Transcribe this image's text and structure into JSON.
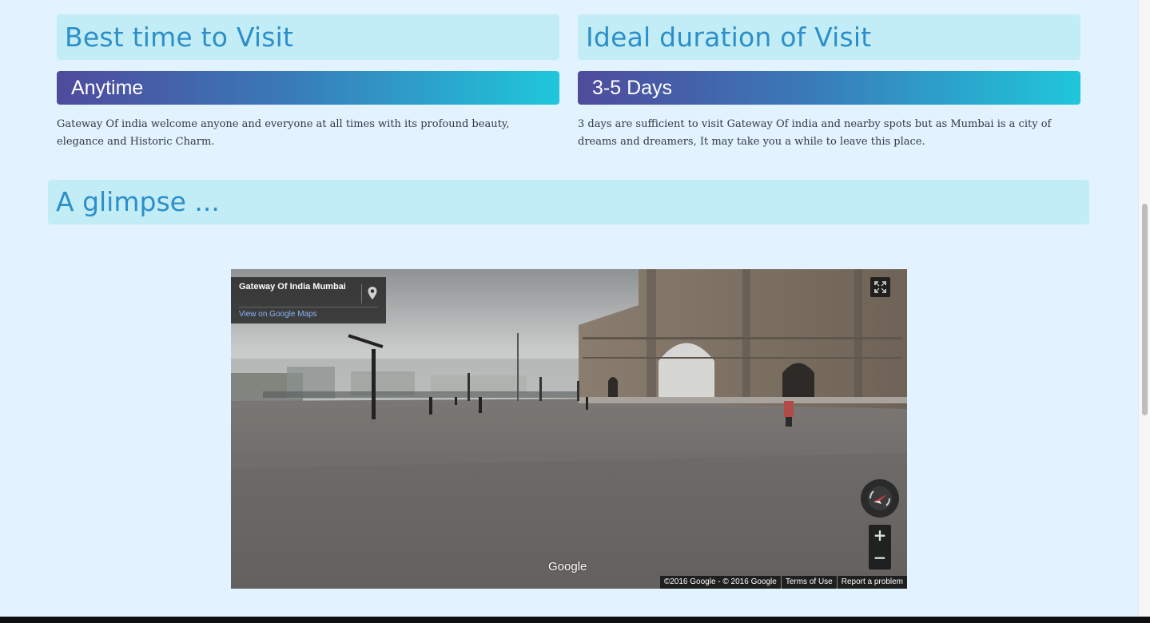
{
  "best_time": {
    "heading": "Best time to Visit",
    "value": "Anytime",
    "description": "Gateway Of india welcome anyone and everyone at all times with its profound beauty, elegance and Historic Charm."
  },
  "duration": {
    "heading": "Ideal duration of Visit",
    "value": "3-5 Days",
    "description": "3 days are sufficient to visit Gateway Of india and nearby spots but as Mumbai is a city of dreams and dreamers, It may take you a while to leave this place."
  },
  "glimpse": {
    "heading": "A glimpse ..."
  },
  "streetview": {
    "place_title": "Gateway Of India Mumbai",
    "view_link": "View on Google Maps",
    "logo": "Google",
    "copyright": "©2016 Google - © 2016 Google",
    "terms": "Terms of Use",
    "report": "Report a problem",
    "zoom_in": "+",
    "zoom_out": "−",
    "icons": [
      "map-pin-icon",
      "fullscreen-icon",
      "compass-icon"
    ]
  },
  "colors": {
    "page_bg": "#e2f2ff",
    "heading_bg": "#c3edf6",
    "heading_text": "#2d8fc9",
    "bar_gradient_start": "#4f4a9c",
    "bar_gradient_end": "#1fc7db"
  }
}
